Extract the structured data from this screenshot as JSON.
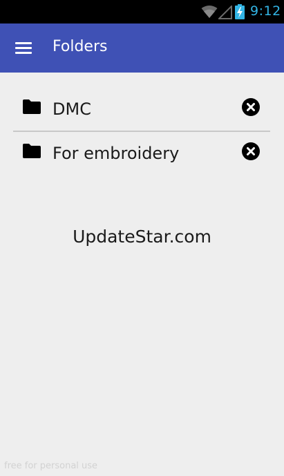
{
  "status_bar": {
    "time": "9:12",
    "icons": [
      "wifi-icon",
      "signal-icon",
      "battery-charging-icon"
    ],
    "clock_color": "#33b5e5"
  },
  "app_bar": {
    "menu_icon": "hamburger-menu-icon",
    "title": "Folders",
    "color": "#3f51b5"
  },
  "folders": [
    {
      "name": "DMC",
      "icon": "folder-icon",
      "action_icon": "remove-circle-icon"
    },
    {
      "name": "For embroidery",
      "icon": "folder-icon",
      "action_icon": "remove-circle-icon"
    }
  ],
  "watermark": {
    "main": "UpdateStar.com",
    "small": "free for personal use"
  }
}
